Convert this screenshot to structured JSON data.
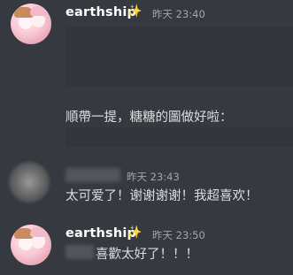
{
  "messages": [
    {
      "author": "earthship",
      "badge_icon": "sparkles-icon",
      "timestamp": "昨天 23:40",
      "text": "順帶一提，糖糖的圖做好啦："
    },
    {
      "author": "",
      "timestamp": "昨天 23:43",
      "text": "太可爱了！谢谢谢谢！我超喜欢！"
    },
    {
      "author": "earthship",
      "badge_icon": "sparkles-icon",
      "timestamp": "昨天 23:50",
      "text": "喜歡太好了！！！"
    }
  ],
  "colors": {
    "background": "#36393f",
    "username": "#ffffff",
    "timestamp": "#a3a6aa",
    "text": "#dcddde",
    "embed": "#32363c"
  }
}
